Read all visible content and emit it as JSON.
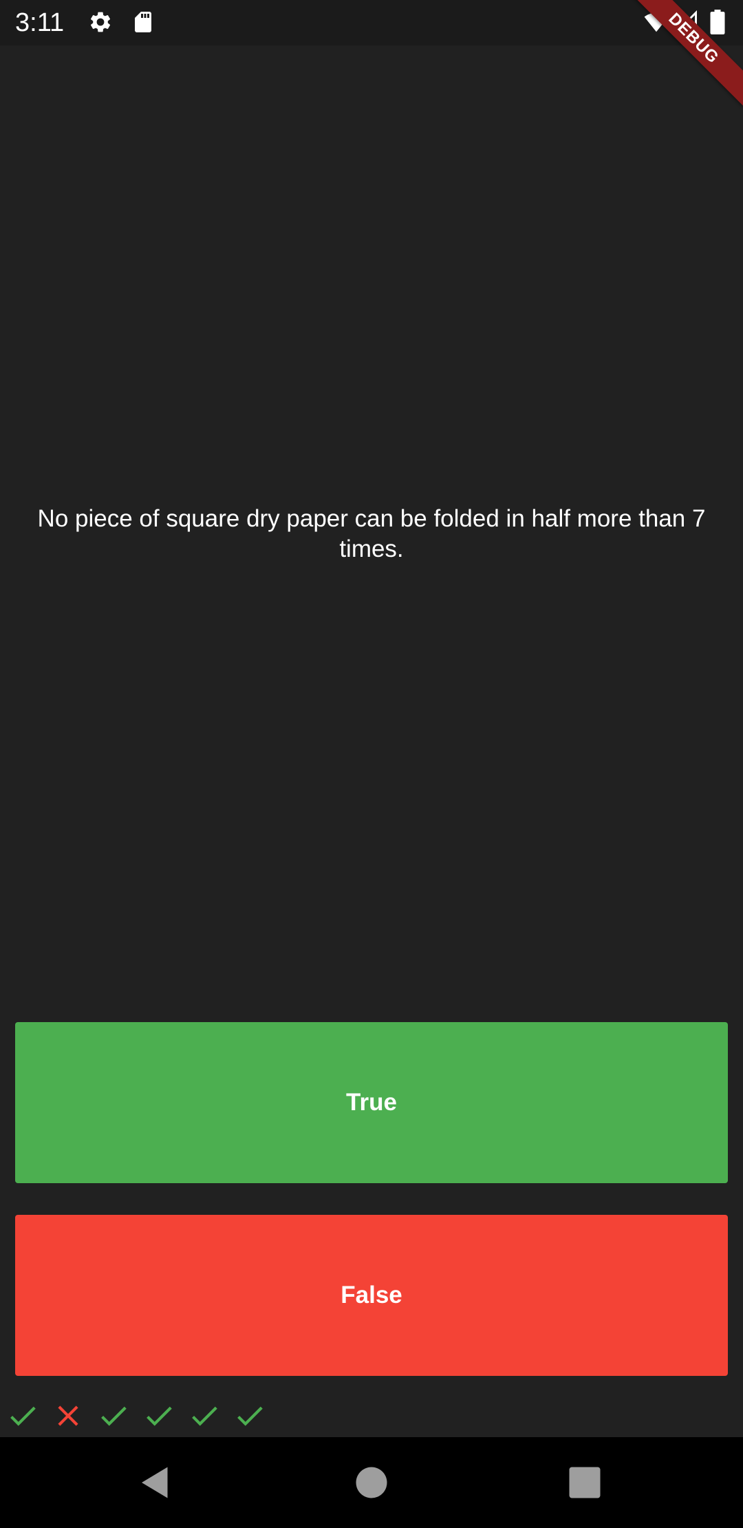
{
  "status_bar": {
    "time": "3:11",
    "icons": [
      "gear-icon",
      "sd-card-icon",
      "wifi-icon",
      "signal-icon",
      "battery-icon"
    ]
  },
  "debug_banner": {
    "label": "DEBUG"
  },
  "quiz": {
    "question": "No piece of square dry paper can be folded in half more than 7 times.",
    "true_label": "True",
    "false_label": "False",
    "true_color": "#4caf50",
    "false_color": "#f44336"
  },
  "score": {
    "results": [
      "correct",
      "wrong",
      "correct",
      "correct",
      "correct",
      "correct"
    ],
    "correct_color": "#4caf50",
    "wrong_color": "#f44336"
  },
  "nav_bar": {
    "icons": [
      "back-icon",
      "home-icon",
      "recents-icon"
    ]
  }
}
